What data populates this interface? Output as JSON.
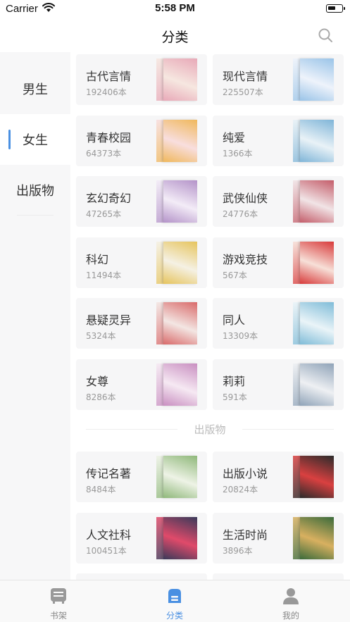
{
  "status_bar": {
    "carrier": "Carrier",
    "time": "5:58 PM"
  },
  "header": {
    "title": "分类"
  },
  "sidebar": {
    "items": [
      {
        "label": "男生"
      },
      {
        "label": "女生"
      },
      {
        "label": "出版物"
      }
    ],
    "selected": "女生"
  },
  "categories": [
    {
      "name": "古代言情",
      "count": "192406本",
      "colors": [
        "#e8a9b8",
        "#f6e7e0"
      ]
    },
    {
      "name": "现代言情",
      "count": "225507本",
      "colors": [
        "#9ac4e8",
        "#eef3fb"
      ]
    },
    {
      "name": "青春校园",
      "count": "64373本",
      "colors": [
        "#f0b85c",
        "#f8dede"
      ]
    },
    {
      "name": "纯爱",
      "count": "1366本",
      "colors": [
        "#7fb5d8",
        "#e9f2f7"
      ]
    },
    {
      "name": "玄幻奇幻",
      "count": "47265本",
      "colors": [
        "#b493c9",
        "#f3ecf7"
      ]
    },
    {
      "name": "武侠仙侠",
      "count": "24776本",
      "colors": [
        "#c45d6a",
        "#f1e4e6"
      ]
    },
    {
      "name": "科幻",
      "count": "11494本",
      "colors": [
        "#e6c45d",
        "#f5f1e4"
      ]
    },
    {
      "name": "游戏竞技",
      "count": "567本",
      "colors": [
        "#d83a3a",
        "#f7e0d8"
      ]
    },
    {
      "name": "悬疑灵异",
      "count": "5324本",
      "colors": [
        "#d96a6a",
        "#f3e6e3"
      ]
    },
    {
      "name": "同人",
      "count": "13309本",
      "colors": [
        "#7fbcd8",
        "#eaf4f8"
      ]
    },
    {
      "name": "女尊",
      "count": "8286本",
      "colors": [
        "#c98fc1",
        "#f6e9f3"
      ]
    },
    {
      "name": "莉莉",
      "count": "591本",
      "colors": [
        "#8fa3b8",
        "#eef0f3"
      ]
    }
  ],
  "publish_section": {
    "title": "出版物",
    "items": [
      {
        "name": "传记名著",
        "count": "8484本",
        "colors": [
          "#8fb87a",
          "#eef3e6"
        ]
      },
      {
        "name": "出版小说",
        "count": "20824本",
        "colors": [
          "#2b2b2b",
          "#d94040"
        ]
      },
      {
        "name": "人文社科",
        "count": "100451本",
        "colors": [
          "#3a3a5a",
          "#e04a6a"
        ]
      },
      {
        "name": "生活时尚",
        "count": "3896本",
        "colors": [
          "#3b6b3b",
          "#d8b060"
        ]
      }
    ]
  },
  "tabbar": {
    "tabs": [
      {
        "label": "书架",
        "icon": "bookshelf-icon"
      },
      {
        "label": "分类",
        "icon": "category-icon"
      },
      {
        "label": "我的",
        "icon": "profile-icon"
      }
    ],
    "active": "分类",
    "accent": "#4a90e2"
  }
}
